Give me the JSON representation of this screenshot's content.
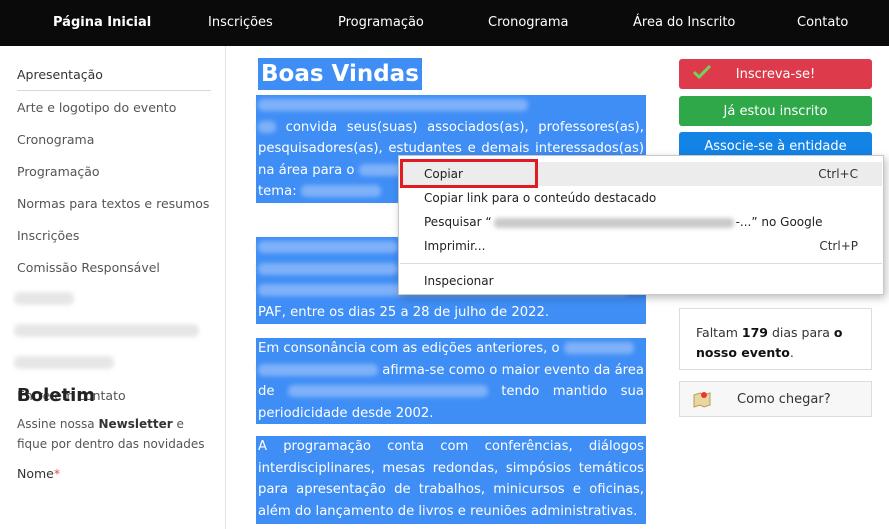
{
  "nav": {
    "items": [
      "Página Inicial",
      "Inscrições",
      "Programação",
      "Cronograma",
      "Área do Inscrito",
      "Contato"
    ]
  },
  "sidebar": {
    "items": [
      "Apresentação",
      "Arte e logotipo do evento",
      "Cronograma",
      "Programação",
      "Normas para textos e resumos",
      "Inscrições",
      "Comissão Responsável"
    ],
    "contact": "Entre em contato",
    "boletim_title": "Boletim",
    "boletim_desc_pre": "Assine nossa ",
    "boletim_desc_bold": "Newsletter",
    "boletim_desc_post": " e fique por dentro das novidades",
    "name_label": "Nome",
    "name_required": "*"
  },
  "main": {
    "title": "Boas Vindas",
    "p1_a": "convida seus(suas) associados(as), professores(as), pesquisadores(as), estudantes e demais interessados(as) na área para o",
    "p1_b": "tema:",
    "p2_tail": "PAF, entre os dias 25 a 28 de julho de 2022.",
    "p3_a": "Em consonância com as edições anteriores, o",
    "p3_b": "afirma-se como o maior evento da área de",
    "p3_c": "tendo mantido sua periodicidade desde 2002.",
    "p4": "A programação conta com conferências, diálogos interdisciplinares, mesas redondas, simpósios temáticos para apresentação de trabalhos, minicursos e oficinas, além do lançamento de livros e reuniões administrativas."
  },
  "right": {
    "register": "Inscreva-se!",
    "already": "Já estou inscrito",
    "associate": "Associe-se à entidade",
    "countdown_pre": "Faltam ",
    "countdown_days": "179",
    "countdown_mid": " dias para ",
    "countdown_bold": "o nosso evento",
    "countdown_end": ".",
    "howto": "Como chegar?"
  },
  "context_menu": {
    "copy": "Copiar",
    "copy_sc": "Ctrl+C",
    "copy_link": "Copiar link para o conteúdo destacado",
    "search_pre": "Pesquisar “",
    "search_post": "-...” no Google",
    "print": "Imprimir...",
    "print_sc": "Ctrl+P",
    "inspect": "Inspecionar"
  },
  "colors": {
    "selection": "#3f8ef6",
    "nav_bg": "#0a0a0a",
    "register": "#dd3b4b",
    "already": "#2fa84a",
    "associate": "#1384e6",
    "highlight_box": "#e01b24"
  }
}
